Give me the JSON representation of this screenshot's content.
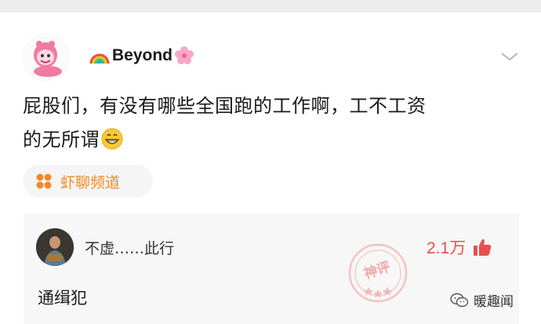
{
  "post": {
    "username_prefix_icon": "rainbow-icon",
    "username": "Beyond",
    "username_suffix_icon": "cherry-blossom-icon",
    "menu_icon": "chevron-down-icon",
    "text_line1": "屁股们，有没有哪些全国跑的工作啊，工不工资",
    "text_line2": "的无所谓",
    "text_emoji": "grinning-face-icon",
    "channel_tag": "虾聊频道",
    "channel_icon": "four-petal-icon"
  },
  "comment": {
    "author": "不虚……此行",
    "text": "通缉犯",
    "likes": "2.1万",
    "like_icon": "thumbs-up-icon",
    "stamp_text": "神评"
  },
  "watermark": {
    "text": "暖趣闻",
    "icon": "wechat-icon"
  },
  "colors": {
    "accent_orange": "#f08a24",
    "like_red": "#e94f4f",
    "stamp_pink": "#f3a6a6",
    "background": "#ededed"
  }
}
